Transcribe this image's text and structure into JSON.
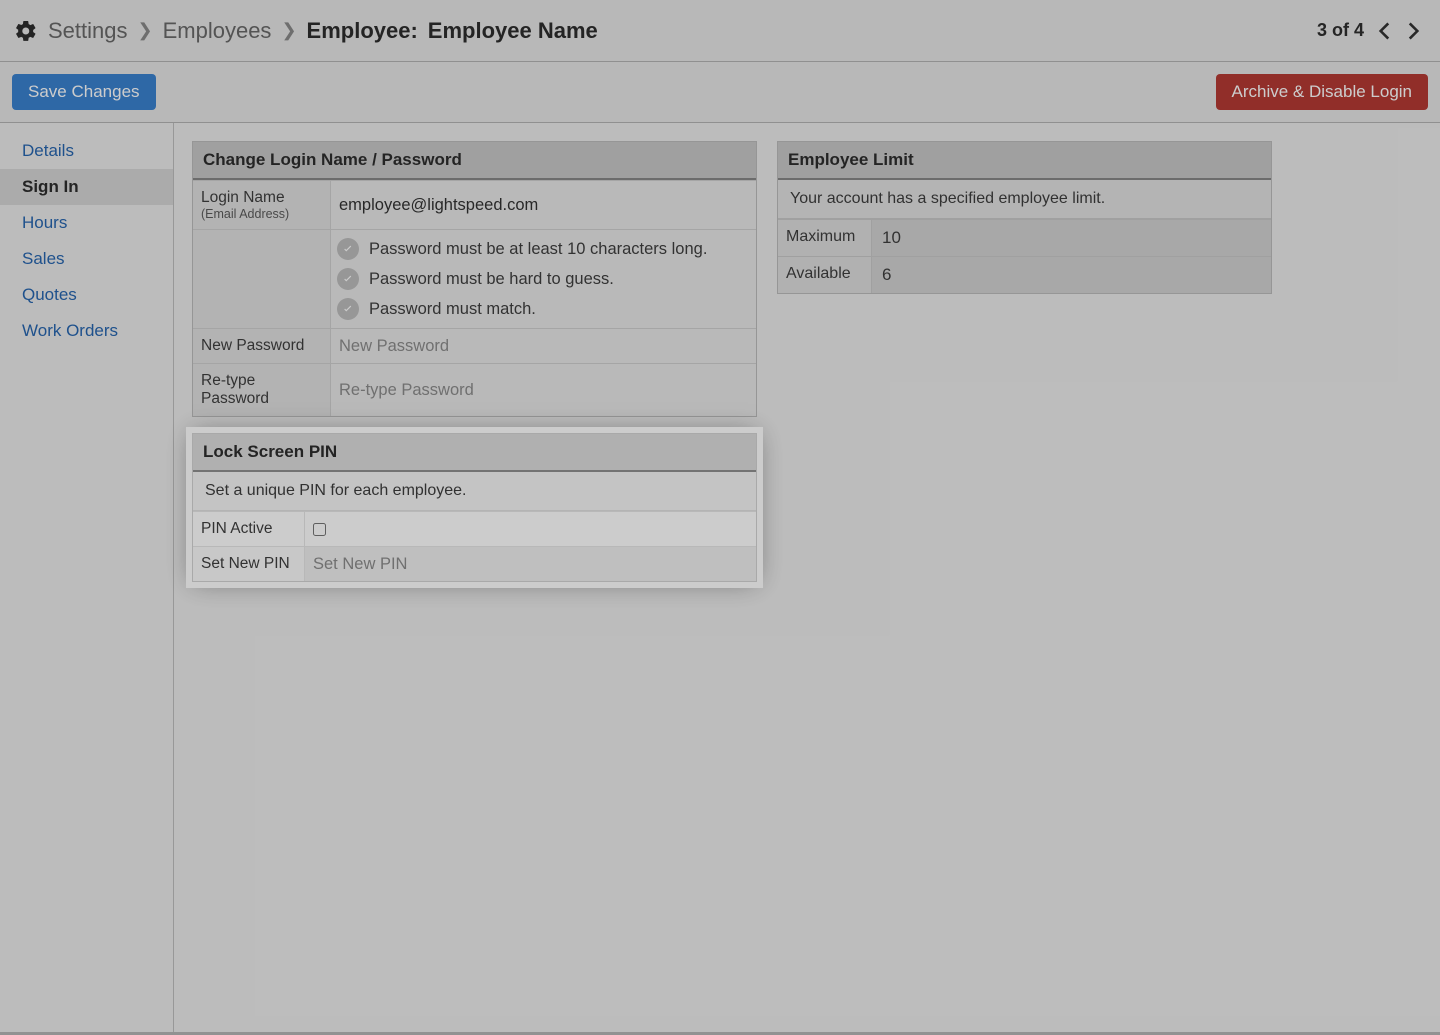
{
  "breadcrumb": {
    "root": "Settings",
    "section": "Employees",
    "item_label": "Employee:",
    "item_name": "Employee Name"
  },
  "pager": {
    "text": "3 of 4"
  },
  "actions": {
    "save": "Save Changes",
    "archive": "Archive & Disable Login"
  },
  "sidebar": {
    "items": [
      {
        "label": "Details"
      },
      {
        "label": "Sign In"
      },
      {
        "label": "Hours"
      },
      {
        "label": "Sales"
      },
      {
        "label": "Quotes"
      },
      {
        "label": "Work Orders"
      }
    ],
    "active_index": 1
  },
  "login_panel": {
    "title": "Change Login Name / Password",
    "login_label": "Login Name",
    "login_sublabel": "(Email Address)",
    "login_value": "employee@lightspeed.com",
    "reqs": [
      "Password must be at least 10 characters long.",
      "Password must be hard to guess.",
      "Password must match."
    ],
    "new_pw_label": "New Password",
    "new_pw_placeholder": "New Password",
    "retype_label": "Re-type Password",
    "retype_placeholder": "Re-type Password"
  },
  "pin_panel": {
    "title": "Lock Screen PIN",
    "note": "Set a unique PIN for each employee.",
    "active_label": "PIN Active",
    "set_label": "Set New PIN",
    "set_placeholder": "Set New PIN"
  },
  "limit_panel": {
    "title": "Employee Limit",
    "note": "Your account has a specified employee limit.",
    "rows": [
      {
        "label": "Maximum",
        "value": "10"
      },
      {
        "label": "Available",
        "value": "6"
      }
    ]
  }
}
